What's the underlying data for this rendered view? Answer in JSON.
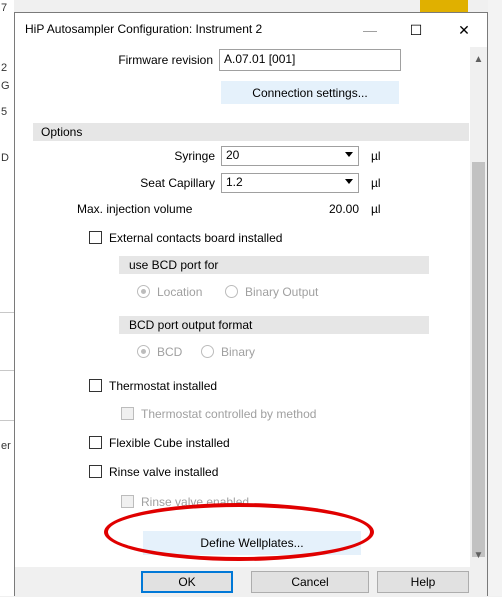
{
  "window": {
    "title": "HiP Autosampler Configuration: Instrument 2",
    "controls": {
      "minimize": "—",
      "maximize": "☐",
      "close": "✕"
    }
  },
  "firmware": {
    "label": "Firmware revision",
    "value": "A.07.01 [001]"
  },
  "connection_button": "Connection settings...",
  "options": {
    "header": "Options",
    "syringe": {
      "label": "Syringe",
      "value": "20",
      "unit": "µl"
    },
    "seat_capillary": {
      "label": "Seat Capillary",
      "value": "1.2",
      "unit": "µl"
    },
    "max_injection": {
      "label": "Max. injection volume",
      "value": "20.00",
      "unit": "µl"
    },
    "external_contacts": {
      "label": "External contacts board installed",
      "checked": false
    },
    "bcd_port": {
      "header": "use BCD port for",
      "options": [
        "Location",
        "Binary Output"
      ],
      "selected": "Location"
    },
    "bcd_format": {
      "header": "BCD port output format",
      "options": [
        "BCD",
        "Binary"
      ],
      "selected": "BCD"
    },
    "thermostat": {
      "label": "Thermostat installed",
      "checked": false
    },
    "thermostat_method": {
      "label": "Thermostat controlled by method",
      "checked": false
    },
    "flexible_cube": {
      "label": "Flexible Cube installed",
      "checked": false
    },
    "rinse_valve": {
      "label": "Rinse valve installed",
      "checked": false
    },
    "rinse_enabled": {
      "label": "Rinse valve enabled",
      "checked": false
    }
  },
  "define_button": "Define Wellplates...",
  "footer": {
    "ok": "OK",
    "cancel": "Cancel",
    "help": "Help"
  },
  "background_chars": [
    "7",
    "2",
    "G",
    "5",
    "D",
    "er"
  ],
  "colors": {
    "accent": "#0078d7",
    "annotation": "#e00000"
  }
}
